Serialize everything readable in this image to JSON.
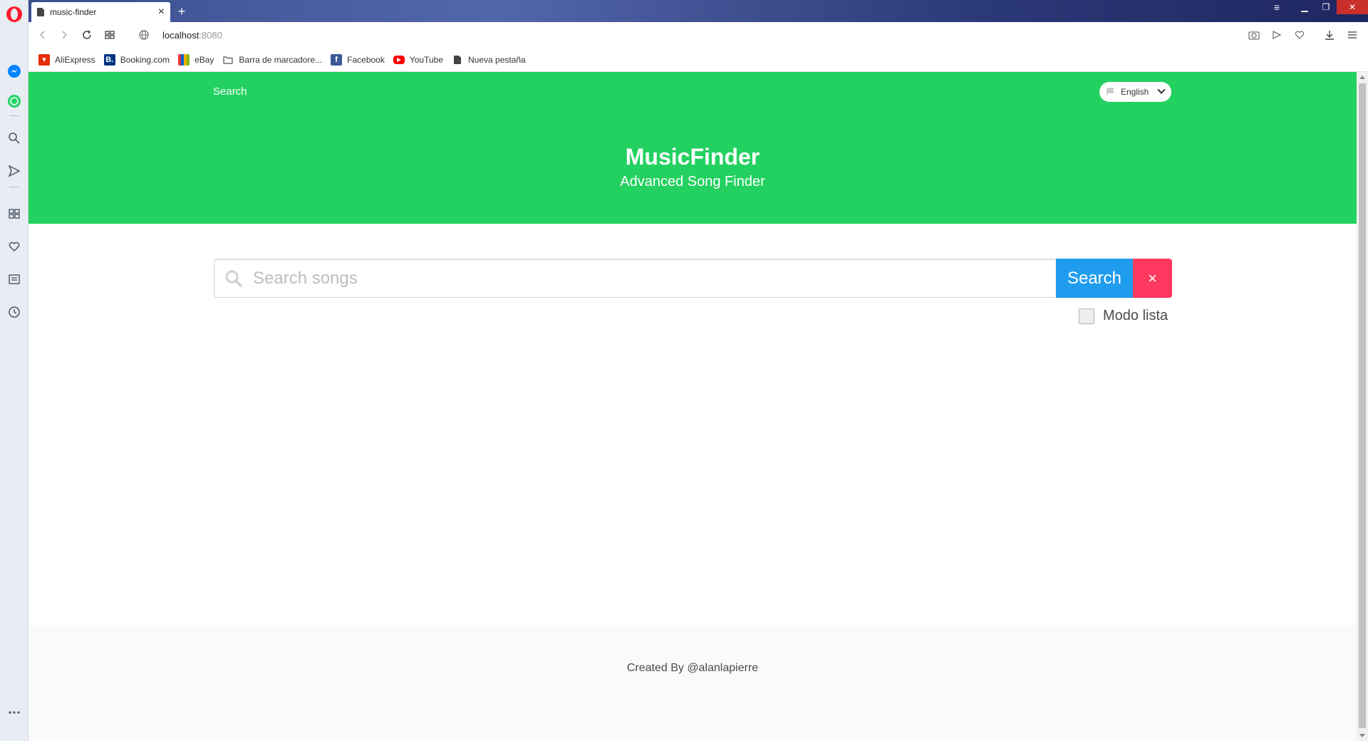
{
  "browser": {
    "tab_title": "music-finder",
    "url_host": "localhost",
    "url_port": ":8080",
    "bookmarks": [
      {
        "label": "AliExpress",
        "icon": "aliexpress-icon",
        "color": "#e62e04"
      },
      {
        "label": "Booking.com",
        "icon": "booking-icon",
        "color": "#003580"
      },
      {
        "label": "eBay",
        "icon": "ebay-icon",
        "color": "#e53238"
      },
      {
        "label": "Barra de marcadore...",
        "icon": "folder-icon",
        "color": "#555555"
      },
      {
        "label": "Facebook",
        "icon": "facebook-icon",
        "color": "#3b5998"
      },
      {
        "label": "YouTube",
        "icon": "youtube-icon",
        "color": "#ff0000"
      },
      {
        "label": "Nueva pestaña",
        "icon": "page-icon",
        "color": "#555555"
      }
    ]
  },
  "header": {
    "nav_link": "Search",
    "language": "English",
    "title": "MusicFinder",
    "subtitle": "Advanced Song Finder"
  },
  "search": {
    "placeholder": "Search songs",
    "button_label": "Search",
    "clear_label": "×",
    "list_mode_label": "Modo lista",
    "list_mode_checked": false
  },
  "footer": {
    "text": "Created By @alanlapierre"
  },
  "colors": {
    "hero": "#23d160",
    "search_button": "#209cee",
    "clear_button": "#ff3860"
  }
}
